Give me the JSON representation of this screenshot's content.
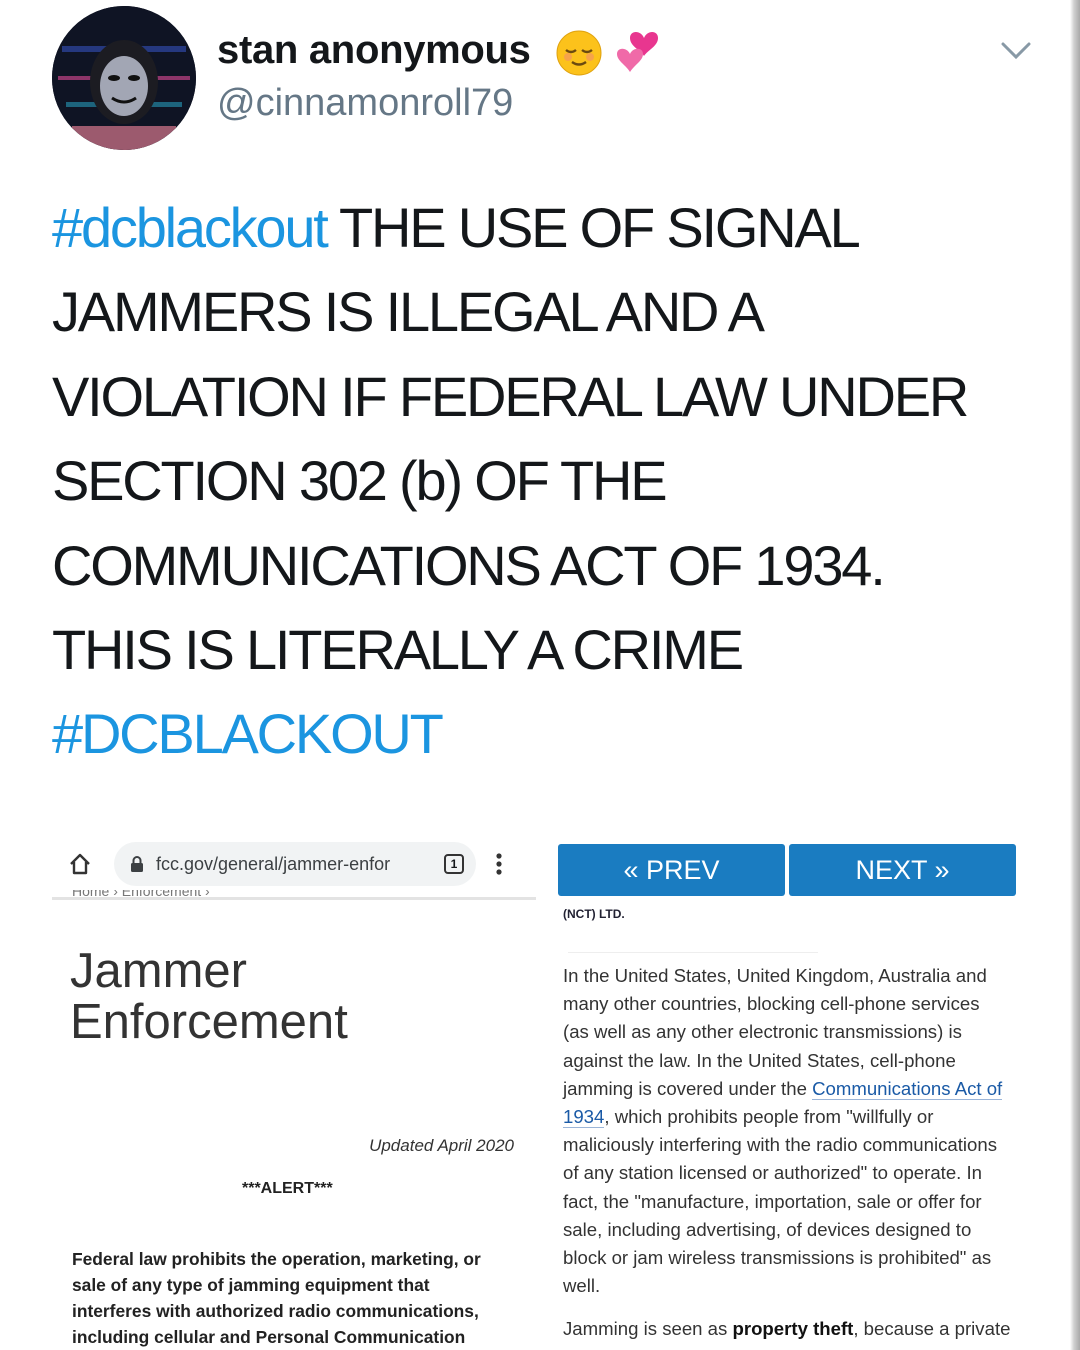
{
  "tweet": {
    "display_name": "stan anonymous",
    "handle": "@cinnamonroll79",
    "name_emojis": [
      "relieved-face-emoji",
      "revolving-hearts-emoji"
    ],
    "menu_icon": "chevron-down-icon",
    "text_lines": [
      {
        "hashtag": "#dcblackout",
        "rest": " THE USE OF SIGNAL"
      },
      {
        "text": "JAMMERS IS ILLEGAL AND A"
      },
      {
        "text": "VIOLATION IF FEDERAL LAW UNDER"
      },
      {
        "text": "SECTION 302 (b) OF THE"
      },
      {
        "text": "COMMUNICATIONS ACT OF 1934."
      },
      {
        "text": "THIS IS LITERALLY A CRIME"
      }
    ],
    "closing_hashtag": "#DCBLACKOUT",
    "hashtag_color": "#1b95e0"
  },
  "left_image": {
    "url": "fcc.gov/general/jammer-enfor",
    "tab_count": "1",
    "breadcrumb": "Home › Enforcement ›",
    "title_line1": "Jammer",
    "title_line2": "Enforcement",
    "updated": "Updated April 2020",
    "alert": "***ALERT***",
    "body_lines": [
      "Federal law prohibits the operation, marketing, or",
      "sale of any type of jamming equipment that",
      "interferes with authorized radio communications,",
      "including cellular and Personal Communication"
    ]
  },
  "right_image": {
    "prev_label": "« PREV",
    "next_label": "NEXT »",
    "button_color": "#1a7cc1",
    "company": "(NCT) LTD.",
    "lines": {
      "l1": "In the United States, United Kingdom, Australia and",
      "l2": "many other countries, blocking cell-phone services",
      "l3": "(as well as any other electronic transmissions) is",
      "l4": "against the law. In the United States, cell-phone",
      "l5_pre": "jamming is covered under the ",
      "l5_link": "Communications Act of",
      "l6_link": "1934",
      "l6_post": ", which prohibits people from \"willfully or",
      "l7": "maliciously interfering with the radio communications",
      "l8": "of any station licensed or authorized\" to operate. In",
      "l9": "fact, the \"manufacture, importation, sale or offer for",
      "l10": "sale, including advertising, of devices designed to",
      "l11": "block or jam wireless transmissions is prohibited\" as",
      "l12": "well."
    },
    "para2_pre": "Jamming is seen as ",
    "para2_bold": "property theft",
    "para2_post": ", because a private"
  }
}
